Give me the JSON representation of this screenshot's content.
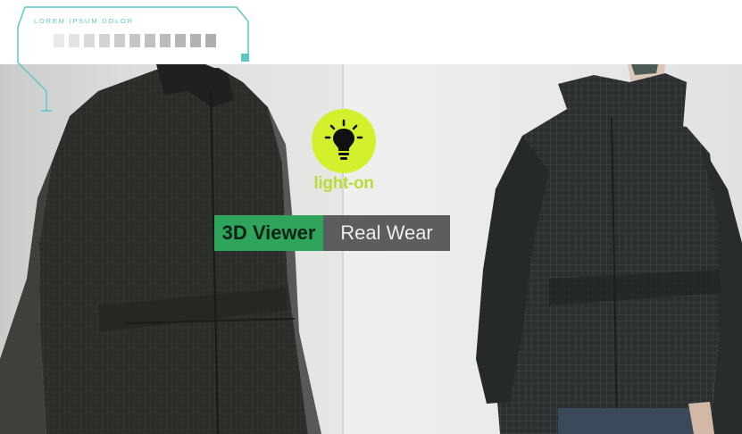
{
  "hud": {
    "title": "LOREM IPSUM DOLOR",
    "accent_color": "#5fc6c8",
    "swatch_colors": [
      "#e9e9e9",
      "#e3e3e3",
      "#dadada",
      "#d3d3d3",
      "#cccccc",
      "#c6c6c6",
      "#c0c0c0",
      "#bbbbbb",
      "#b7b7b7",
      "#b2b2b2",
      "#aeaeae"
    ]
  },
  "light": {
    "icon": "lightbulb-icon",
    "label": "light-on",
    "color": "#d4ef2c"
  },
  "toggle": {
    "options": [
      "3D Viewer",
      "Real Wear"
    ],
    "selected": "3D Viewer",
    "active_color": "#2fa55b",
    "inactive_color": "#5b5e5d"
  },
  "scene": {
    "left_panel": "3D rendered black jacket",
    "right_panel": "photo of model wearing black jacket"
  }
}
